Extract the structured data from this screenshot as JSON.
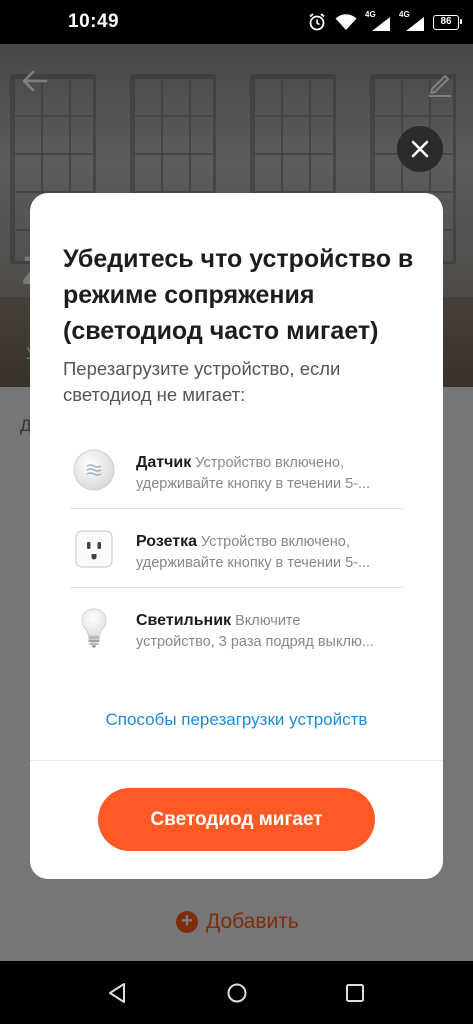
{
  "status_bar": {
    "time": "10:49",
    "network_1": "4G",
    "network_2": "4G",
    "battery": "86"
  },
  "background": {
    "partial_title": "Z",
    "partial_subtitle": "У",
    "partial_label": "Д",
    "add_button_label": "Добавить",
    "accent_color": "#ff5a1f"
  },
  "modal": {
    "title": "Убедитесь что устройство в режиме сопряжения (светодиод часто мигает)",
    "subtitle": "Перезагрузите устройство, если светодиод не мигает:",
    "devices": [
      {
        "name": "Датчик",
        "line1": "Устройство включено,",
        "line2": "удерживайте кнопку в течении 5-...",
        "icon": "sensor-icon"
      },
      {
        "name": "Розетка",
        "line1": "Устройство включено,",
        "line2": "удерживайте кнопку в течении 5-...",
        "icon": "socket-icon"
      },
      {
        "name": "Светильник",
        "line1": "Включите",
        "line2": "устройство, 3 раза подряд выклю...",
        "icon": "bulb-icon"
      }
    ],
    "reset_link": "Способы перезагрузки устройств",
    "primary_button": "Светодиод мигает",
    "primary_color": "#ff5a26",
    "link_color": "#1c8ddb"
  }
}
